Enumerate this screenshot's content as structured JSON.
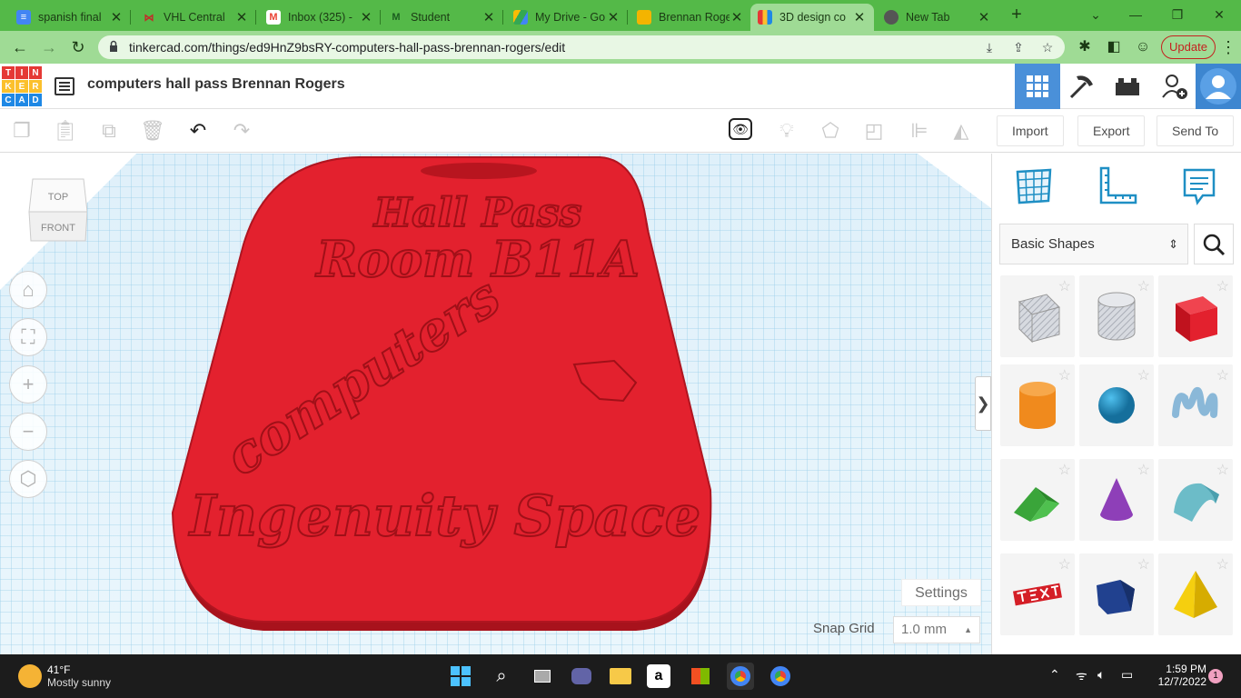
{
  "browser": {
    "tabs": [
      {
        "title": "spanish final",
        "icon": "docs-icon",
        "color": "#4285f4"
      },
      {
        "title": "VHL Central",
        "icon": "vhl-icon",
        "color": "#d44"
      },
      {
        "title": "Inbox (325) -",
        "icon": "gmail-icon",
        "color": "#ea4335"
      },
      {
        "title": "Student",
        "icon": "student-icon",
        "color": "#2e7d32"
      },
      {
        "title": "My Drive - Go",
        "icon": "drive-icon",
        "color": "#fbbc04"
      },
      {
        "title": "Brennan Roge",
        "icon": "slides-icon",
        "color": "#f4b400"
      },
      {
        "title": "3D design co",
        "icon": "tinkercad-icon",
        "color": "#4a90d9"
      },
      {
        "title": "New Tab",
        "icon": "chrome-icon",
        "color": "#555"
      }
    ],
    "active_tab": 6,
    "url": "tinkercad.com/things/ed9HnZ9bsRY-computers-hall-pass-brennan-rogers/edit",
    "update_label": "Update"
  },
  "app": {
    "logo_letters": [
      "T",
      "I",
      "N",
      "K",
      "E",
      "R",
      "C",
      "A",
      "D"
    ],
    "design_title": "computers hall pass Brennan Rogers"
  },
  "toolbar": {
    "import_label": "Import",
    "export_label": "Export",
    "sendto_label": "Send To"
  },
  "workplane": {
    "viewcube_top": "TOP",
    "viewcube_front": "FRONT",
    "settings_label": "Settings",
    "snap_label": "Snap Grid",
    "snap_value": "1.0 mm",
    "model_text": {
      "line1": "Hall Pass",
      "line2": "Room B11A",
      "line3": "computers",
      "line4": "Ingenuity Space"
    },
    "colors": {
      "base": "#e3212e",
      "grid": "#8ec9e6"
    }
  },
  "panel": {
    "category": "Basic Shapes",
    "shapes": [
      {
        "name": "box-hole",
        "color": "#c9ccd3"
      },
      {
        "name": "cylinder-hole",
        "color": "#c9ccd3"
      },
      {
        "name": "box",
        "color": "#e3212e"
      },
      {
        "name": "cylinder",
        "color": "#f08a1d"
      },
      {
        "name": "sphere",
        "color": "#1f8fc4"
      },
      {
        "name": "scribble",
        "color": "#8ab8d8"
      },
      {
        "name": "roof",
        "color": "#3aa53a"
      },
      {
        "name": "cone",
        "color": "#8e3fb8"
      },
      {
        "name": "round-roof",
        "color": "#6cbcc8"
      },
      {
        "name": "text",
        "color": "#d41e26"
      },
      {
        "name": "polygon",
        "color": "#21418f"
      },
      {
        "name": "pyramid",
        "color": "#f5cf0f"
      }
    ]
  },
  "taskbar": {
    "temperature": "41°F",
    "weather": "Mostly sunny",
    "time": "1:59 PM",
    "date": "12/7/2022",
    "notifications": "1"
  }
}
